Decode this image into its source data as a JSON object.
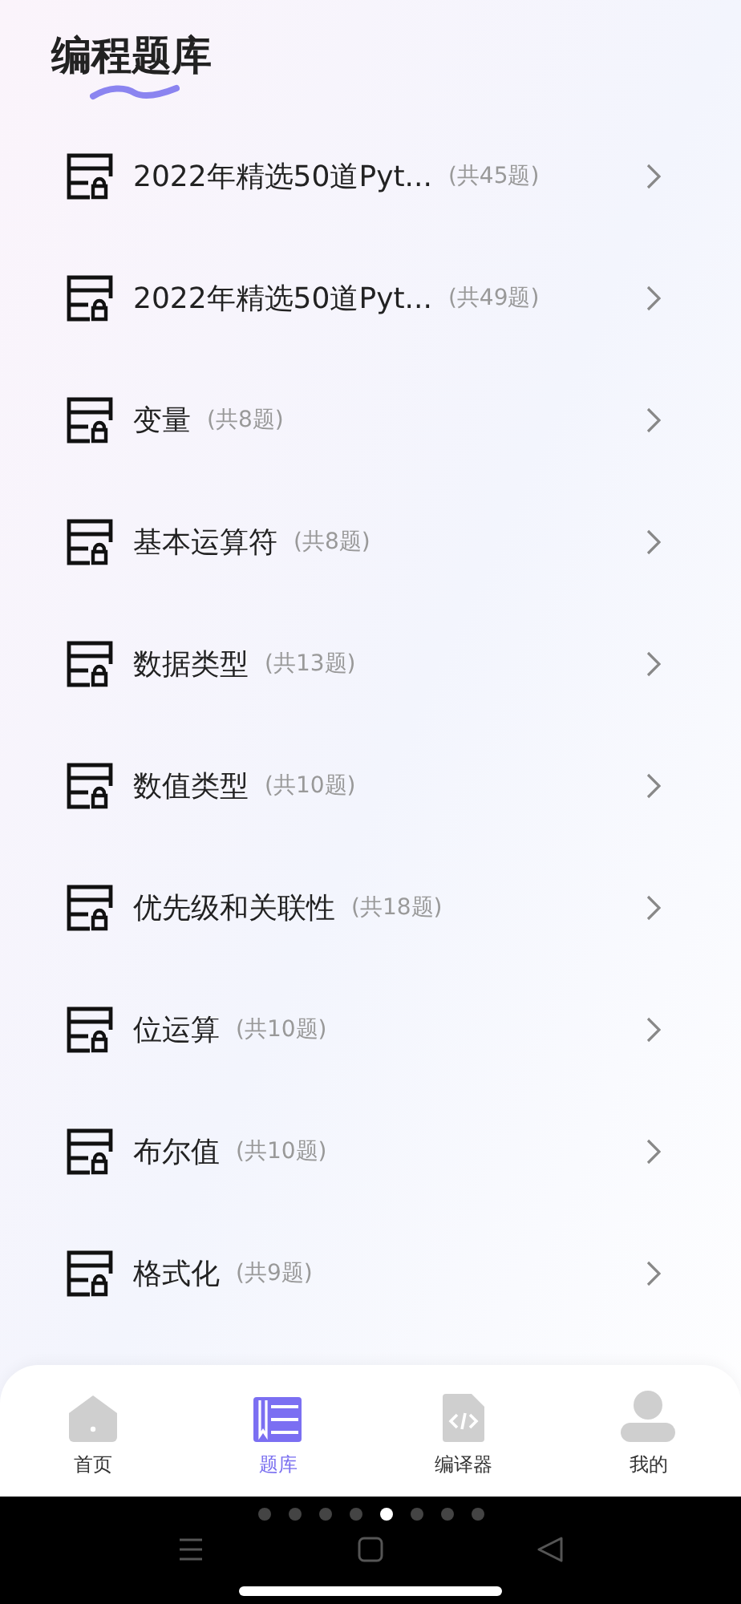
{
  "title": "编程题库",
  "items": [
    {
      "name": "2022年精选50道Pyt...",
      "count": "(共45题)"
    },
    {
      "name": "2022年精选50道Pyt...",
      "count": "(共49题)"
    },
    {
      "name": "变量",
      "count": "(共8题)"
    },
    {
      "name": "基本运算符",
      "count": "(共8题)"
    },
    {
      "name": "数据类型",
      "count": "(共13题)"
    },
    {
      "name": "数值类型",
      "count": "(共10题)"
    },
    {
      "name": "优先级和关联性",
      "count": "(共18题)"
    },
    {
      "name": "位运算",
      "count": "(共10题)"
    },
    {
      "name": "布尔值",
      "count": "(共10题)"
    },
    {
      "name": "格式化",
      "count": "(共9题)"
    }
  ],
  "tabs": [
    {
      "label": "首页",
      "kind": "home",
      "selected": false
    },
    {
      "label": "题库",
      "kind": "bank",
      "selected": true
    },
    {
      "label": "编译器",
      "kind": "compiler",
      "selected": false
    },
    {
      "label": "我的",
      "kind": "profile",
      "selected": false
    }
  ],
  "page_dots": [
    {
      "selected": false
    },
    {
      "selected": false
    },
    {
      "selected": false
    },
    {
      "selected": false
    },
    {
      "selected": true
    },
    {
      "selected": false
    },
    {
      "selected": false
    },
    {
      "selected": false
    }
  ]
}
